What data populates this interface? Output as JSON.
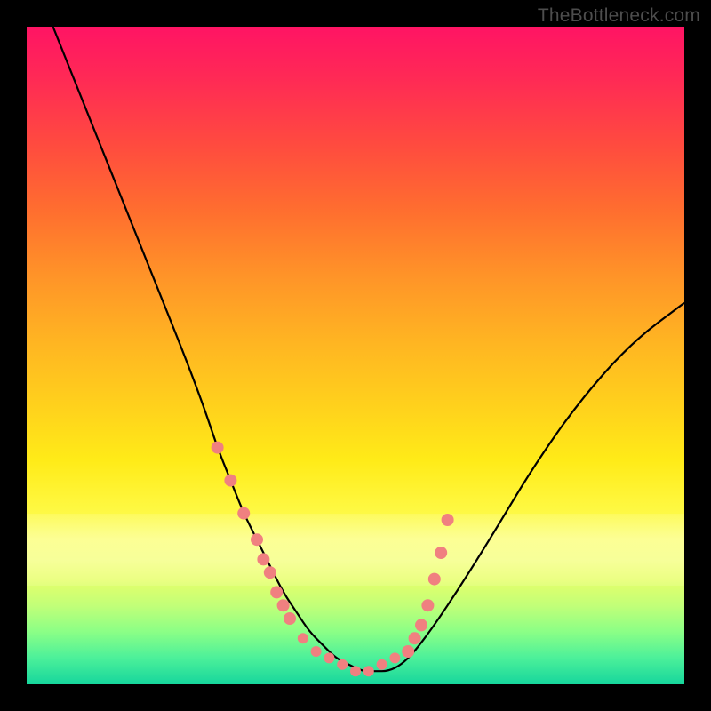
{
  "watermark": "TheBottleneck.com",
  "chart_data": {
    "type": "line",
    "title": "",
    "xlabel": "",
    "ylabel": "",
    "xlim": [
      0,
      100
    ],
    "ylim": [
      0,
      100
    ],
    "series": [
      {
        "name": "curve",
        "x": [
          4,
          8,
          12,
          16,
          20,
          24,
          27,
          29,
          31,
          33,
          35,
          37,
          39,
          41,
          43,
          45,
          47,
          49,
          51,
          53,
          55,
          57,
          59,
          62,
          66,
          71,
          77,
          84,
          92,
          100
        ],
        "y": [
          100,
          90,
          80,
          70,
          60,
          50,
          42,
          36,
          31,
          26,
          22,
          18,
          14,
          11,
          8,
          6,
          4,
          3,
          2,
          2,
          2,
          3,
          5,
          9,
          15,
          23,
          33,
          43,
          52,
          58
        ]
      },
      {
        "name": "markers-left",
        "x": [
          29,
          31,
          33,
          35,
          36,
          37,
          38,
          39,
          40
        ],
        "y": [
          36,
          31,
          26,
          22,
          19,
          17,
          14,
          12,
          10
        ]
      },
      {
        "name": "markers-right",
        "x": [
          58,
          59,
          60,
          61,
          62,
          63,
          64
        ],
        "y": [
          5,
          7,
          9,
          12,
          16,
          20,
          25
        ]
      },
      {
        "name": "markers-bottom",
        "x": [
          42,
          44,
          46,
          48,
          50,
          52,
          54,
          56
        ],
        "y": [
          7,
          5,
          4,
          3,
          2,
          2,
          3,
          4
        ]
      }
    ],
    "marker_color": "#f08080",
    "line_color": "#000000"
  }
}
